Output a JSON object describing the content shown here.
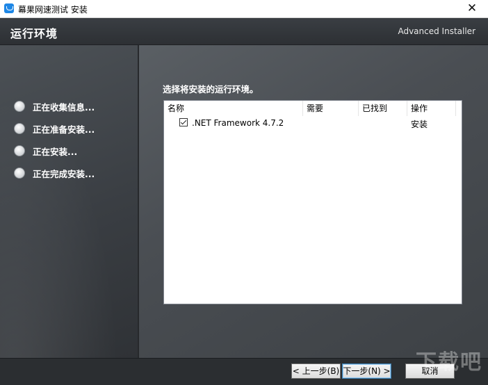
{
  "window": {
    "title": "幕果网速测试 安装",
    "close_glyph": "✕"
  },
  "header": {
    "title": "运行环境",
    "brand": "Advanced Installer"
  },
  "steps": [
    {
      "label": "正在收集信息..."
    },
    {
      "label": "正在准备安装..."
    },
    {
      "label": "正在安装..."
    },
    {
      "label": "正在完成安装..."
    }
  ],
  "main": {
    "instruction": "选择将安装的运行环境。",
    "columns": [
      "名称",
      "需要",
      "已找到",
      "操作"
    ],
    "rows": [
      {
        "name": ".NET Framework 4.7.2",
        "required": "",
        "found": "",
        "action": "安装",
        "checked": true
      }
    ]
  },
  "buttons": {
    "back": "< 上一步(B)",
    "next": "下一步(N) >",
    "cancel": "取消"
  },
  "watermark": "下载吧"
}
